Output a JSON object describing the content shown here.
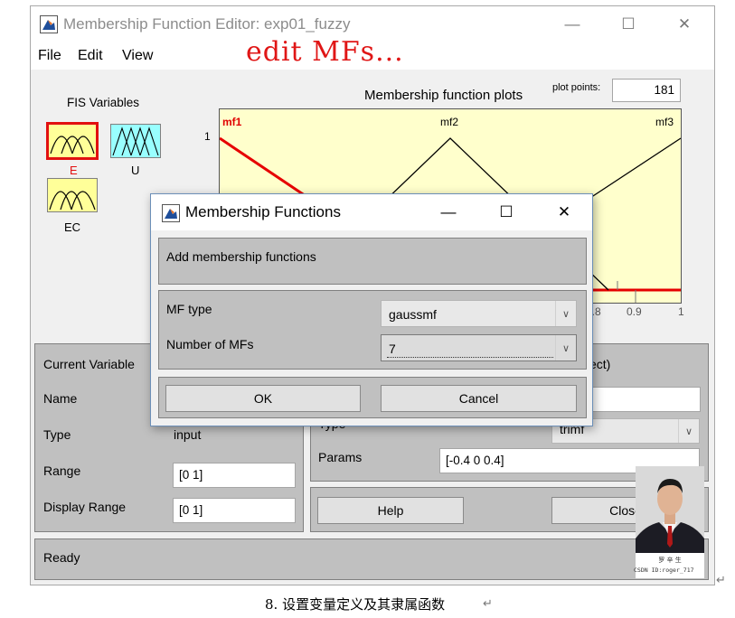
{
  "window": {
    "title": "Membership Function Editor: exp01_fuzzy"
  },
  "menu": {
    "file": "File",
    "edit": "Edit",
    "view": "View"
  },
  "annotation": {
    "overlay_text": "edit MFs...",
    "color": "#e01616"
  },
  "fis_panel": {
    "title": "FIS Variables",
    "variables": [
      {
        "name": "E",
        "selected": true,
        "color": "#ffff99"
      },
      {
        "name": "U",
        "selected": false,
        "color": "#99ffff"
      },
      {
        "name": "EC",
        "selected": false,
        "color": "#ffff99"
      }
    ]
  },
  "plot": {
    "title": "Membership function plots",
    "plot_points_label": "plot points:",
    "plot_points_value": "181",
    "background": "#ffffcc",
    "y_tick": "1",
    "mf_labels": [
      "mf1",
      "mf2",
      "mf3"
    ],
    "x_ticks": [
      "0.8",
      "0.9",
      "1"
    ]
  },
  "current_variable": {
    "header": "Current Variable",
    "name_label": "Name",
    "type_label": "Type",
    "type_value": "input",
    "range_label": "Range",
    "range_value": "[0 1]",
    "display_range_label": "Display Range",
    "display_range_value": "[0 1]"
  },
  "current_mf": {
    "header_fragment": "ect)",
    "type_fragment": "Type",
    "type_value_fragment": "trimf",
    "params_label": "Params",
    "params_value": "[-0.4 0 0.4]"
  },
  "buttons": {
    "help": "Help",
    "close": "Close"
  },
  "status": {
    "text": "Ready"
  },
  "dialog": {
    "title": "Membership Functions",
    "message": "Add membership functions",
    "mf_type_label": "MF type",
    "mf_type_value": "gaussmf",
    "num_mfs_label": "Number of MFs",
    "num_mfs_value": "7",
    "ok": "OK",
    "cancel": "Cancel"
  },
  "avatar": {
    "caption": "CSDN ID:roger_717"
  },
  "page": {
    "caption": "8. 设置变量定义及其隶属函数",
    "return_mark": "↵"
  }
}
